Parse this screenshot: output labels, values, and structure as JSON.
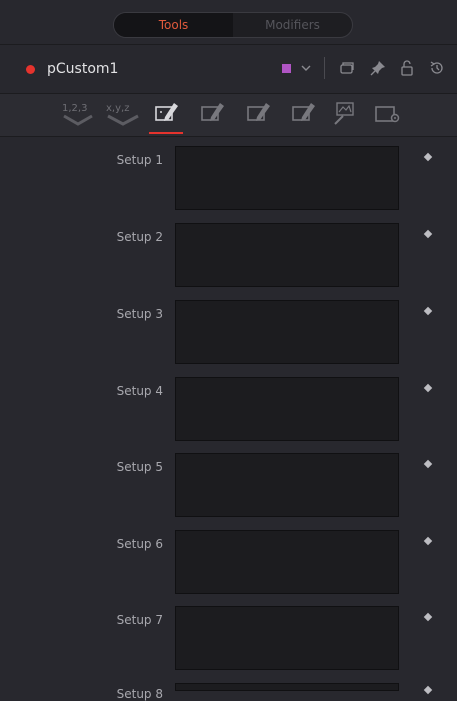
{
  "tabs": {
    "tools": "Tools",
    "modifiers": "Modifiers"
  },
  "header": {
    "tool_name": "pCustom1",
    "color_chip": "#b055c4"
  },
  "toolbar": {
    "items": [
      {
        "label": "1,2,3",
        "icon": "numbers-tab-icon"
      },
      {
        "label": "x,y,z",
        "icon": "position-tab-icon"
      },
      {
        "icon": "setup-script-tab-icon",
        "active": true
      },
      {
        "icon": "script-tab-icon"
      },
      {
        "icon": "script-tab-icon"
      },
      {
        "icon": "script-tab-icon"
      },
      {
        "icon": "image-tab-icon"
      },
      {
        "icon": "settings-tab-icon"
      }
    ]
  },
  "setups": [
    {
      "label": "Setup 1",
      "value": ""
    },
    {
      "label": "Setup 2",
      "value": ""
    },
    {
      "label": "Setup 3",
      "value": ""
    },
    {
      "label": "Setup 4",
      "value": ""
    },
    {
      "label": "Setup 5",
      "value": ""
    },
    {
      "label": "Setup 6",
      "value": ""
    },
    {
      "label": "Setup 7",
      "value": ""
    },
    {
      "label": "Setup 8",
      "value": ""
    }
  ],
  "colors": {
    "accent": "#e05a3c",
    "record": "#e5332d",
    "background": "#28282e"
  }
}
